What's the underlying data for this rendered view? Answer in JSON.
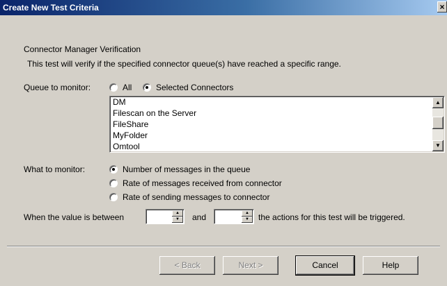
{
  "window": {
    "title": "Create New Test Criteria",
    "close_glyph": "×"
  },
  "section": {
    "heading": "Connector Manager Verification",
    "description": "This test will verify if the specified connector queue(s) have reached a specific range."
  },
  "queue": {
    "label": "Queue to monitor:",
    "options": [
      {
        "label": "All",
        "checked": false
      },
      {
        "label": "Selected Connectors",
        "checked": true
      }
    ],
    "connectors": [
      "DM",
      "Filescan on the Server",
      "FileShare",
      "MyFolder",
      "Omtool"
    ]
  },
  "monitor": {
    "label": "What to monitor:",
    "options": [
      {
        "label": "Number of messages in the queue",
        "checked": true
      },
      {
        "label": "Rate of messages received from connector",
        "checked": false
      },
      {
        "label": "Rate of sending messages to connector",
        "checked": false
      }
    ]
  },
  "range": {
    "prefix": "When the value is between",
    "and": "and",
    "suffix": "the actions for this test will be triggered.",
    "low_value": "",
    "high_value": ""
  },
  "buttons": {
    "back": "< Back",
    "next": "Next >",
    "cancel": "Cancel",
    "help": "Help"
  },
  "icons": {
    "scroll_up": "scroll-up-arrow",
    "scroll_down": "scroll-down-arrow"
  }
}
